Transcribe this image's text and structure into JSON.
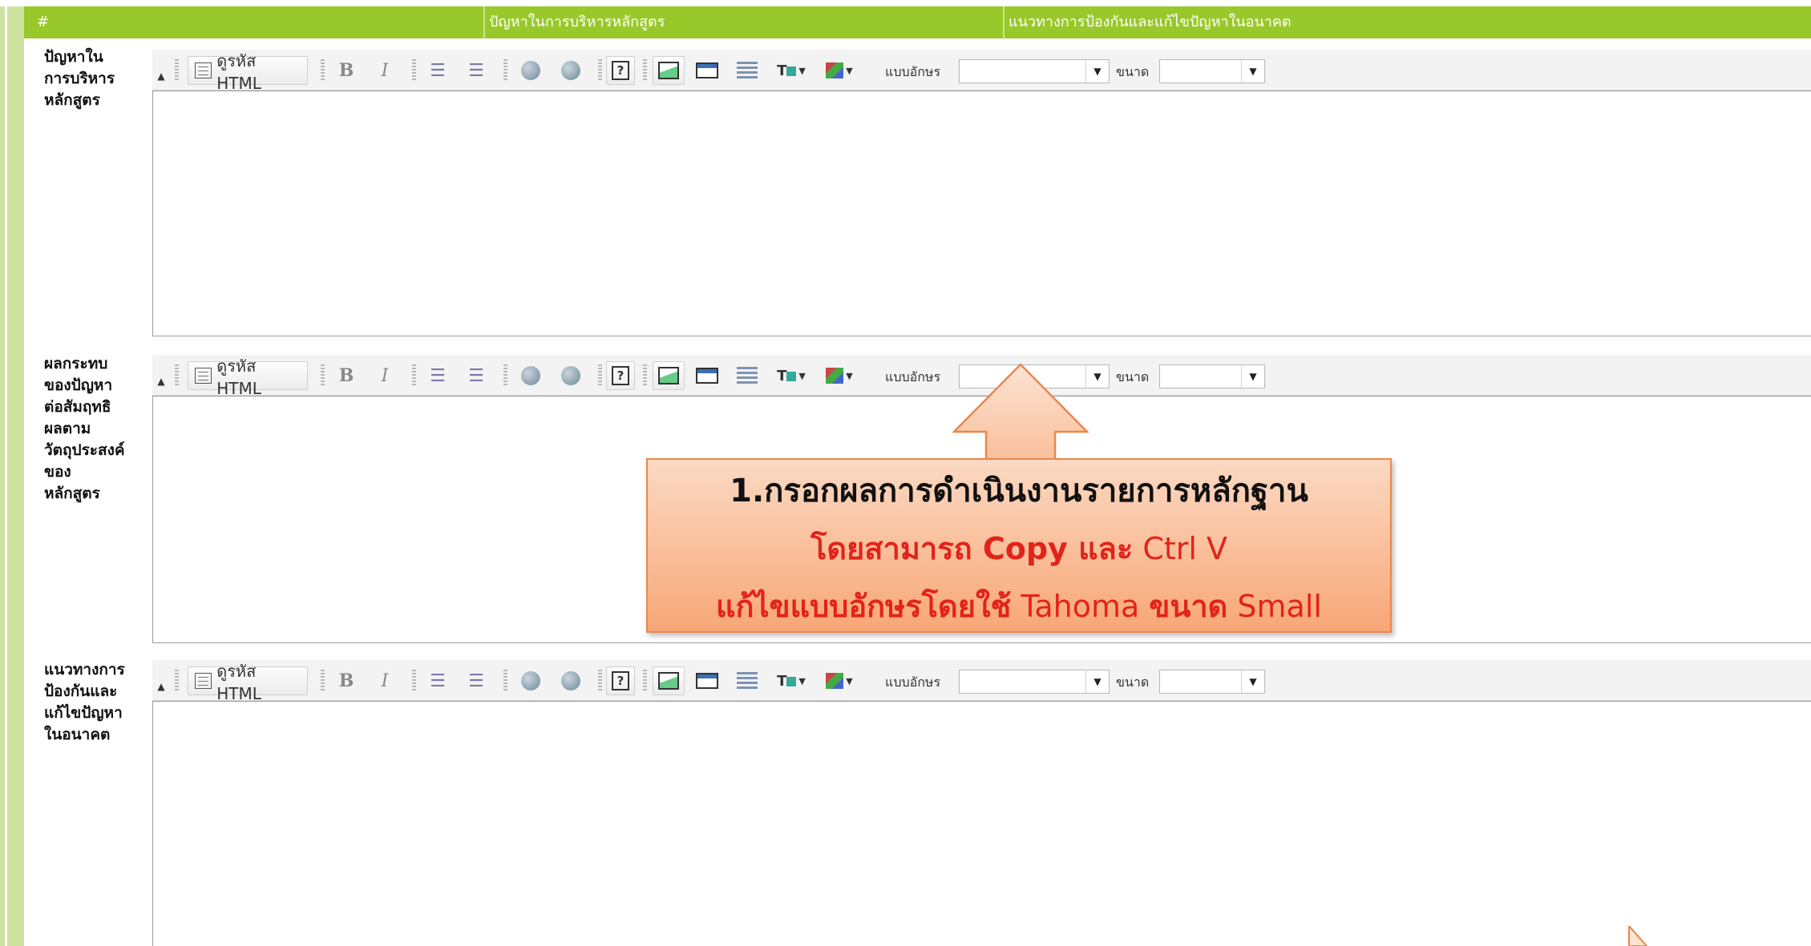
{
  "header": {
    "col_index": "#",
    "col_problem": "ปัญหาในการบริหารหลักสูตร",
    "col_solution": "แนวทางการป้องกันและแก้ไขปัญหาในอนาคต"
  },
  "rows": [
    {
      "label": "ปัญหาใน\nการบริหาร\nหลักสูตร"
    },
    {
      "label": "ผลกระทบ\nของปัญหา\nต่อสัมฤทธิ\nผลตาม\nวัตถุประสงค์\nของ\nหลักสูตร"
    },
    {
      "label": "แนวทางการ\nป้องกันและ\nแก้ไขปัญหา\nในอนาคต"
    }
  ],
  "toolbar": {
    "html_source_label": "ดูรหัส HTML",
    "font_label": "แบบอักษร",
    "size_label": "ขนาด",
    "font_value": "",
    "size_value": "",
    "icons": [
      "source-icon",
      "bold-icon",
      "italic-icon",
      "ordered-list-icon",
      "bullet-list-icon",
      "link-icon",
      "unlink-icon",
      "help-icon",
      "image-icon",
      "table-icon",
      "horizontal-rule-icon",
      "text-color-icon",
      "background-color-icon"
    ]
  },
  "callout": {
    "line1": "1.กรอกผลการดำเนินงานรายการหลักฐาน",
    "line2_a": "โดยสามารถ Copy ",
    "line2_b": "และ",
    "line2_c": " Ctrl V",
    "line3_a": "แก้ไขแบบอักษรโดยใช้",
    "line3_b": " Tahoma ",
    "line3_c": "ขนาด",
    "line3_d": " Small"
  },
  "colors": {
    "header_green": "#99c82b",
    "stripe_green": "#cfe3a0",
    "callout_orange": "#f8a776",
    "callout_red_text": "#e2231a"
  }
}
